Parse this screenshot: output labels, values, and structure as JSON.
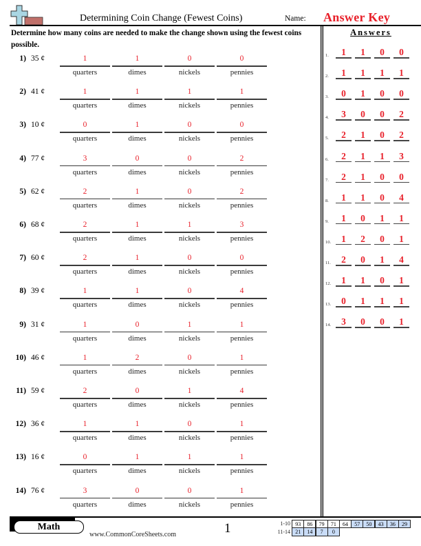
{
  "header": {
    "title": "Determining Coin Change (Fewest Coins)",
    "name_label": "Name:",
    "answer_key": "Answer Key"
  },
  "instructions": "Determine how many coins are needed to make the change shown using the fewest coins possible.",
  "coin_labels": [
    "quarters",
    "dimes",
    "nickels",
    "pennies"
  ],
  "problems": [
    {
      "num": "1)",
      "amount": "35 ¢",
      "answers": [
        "1",
        "1",
        "0",
        "0"
      ]
    },
    {
      "num": "2)",
      "amount": "41 ¢",
      "answers": [
        "1",
        "1",
        "1",
        "1"
      ]
    },
    {
      "num": "3)",
      "amount": "10 ¢",
      "answers": [
        "0",
        "1",
        "0",
        "0"
      ]
    },
    {
      "num": "4)",
      "amount": "77 ¢",
      "answers": [
        "3",
        "0",
        "0",
        "2"
      ]
    },
    {
      "num": "5)",
      "amount": "62 ¢",
      "answers": [
        "2",
        "1",
        "0",
        "2"
      ]
    },
    {
      "num": "6)",
      "amount": "68 ¢",
      "answers": [
        "2",
        "1",
        "1",
        "3"
      ]
    },
    {
      "num": "7)",
      "amount": "60 ¢",
      "answers": [
        "2",
        "1",
        "0",
        "0"
      ]
    },
    {
      "num": "8)",
      "amount": "39 ¢",
      "answers": [
        "1",
        "1",
        "0",
        "4"
      ]
    },
    {
      "num": "9)",
      "amount": "31 ¢",
      "answers": [
        "1",
        "0",
        "1",
        "1"
      ]
    },
    {
      "num": "10)",
      "amount": "46 ¢",
      "answers": [
        "1",
        "2",
        "0",
        "1"
      ]
    },
    {
      "num": "11)",
      "amount": "59 ¢",
      "answers": [
        "2",
        "0",
        "1",
        "4"
      ]
    },
    {
      "num": "12)",
      "amount": "36 ¢",
      "answers": [
        "1",
        "1",
        "0",
        "1"
      ]
    },
    {
      "num": "13)",
      "amount": "16 ¢",
      "answers": [
        "0",
        "1",
        "1",
        "1"
      ]
    },
    {
      "num": "14)",
      "amount": "76 ¢",
      "answers": [
        "3",
        "0",
        "0",
        "1"
      ]
    }
  ],
  "answers_panel": {
    "title": "Answers",
    "rows": [
      {
        "num": "1.",
        "values": [
          "1",
          "1",
          "0",
          "0"
        ]
      },
      {
        "num": "2.",
        "values": [
          "1",
          "1",
          "1",
          "1"
        ]
      },
      {
        "num": "3.",
        "values": [
          "0",
          "1",
          "0",
          "0"
        ]
      },
      {
        "num": "4.",
        "values": [
          "3",
          "0",
          "0",
          "2"
        ]
      },
      {
        "num": "5.",
        "values": [
          "2",
          "1",
          "0",
          "2"
        ]
      },
      {
        "num": "6.",
        "values": [
          "2",
          "1",
          "1",
          "3"
        ]
      },
      {
        "num": "7.",
        "values": [
          "2",
          "1",
          "0",
          "0"
        ]
      },
      {
        "num": "8.",
        "values": [
          "1",
          "1",
          "0",
          "4"
        ]
      },
      {
        "num": "9.",
        "values": [
          "1",
          "0",
          "1",
          "1"
        ]
      },
      {
        "num": "10.",
        "values": [
          "1",
          "2",
          "0",
          "1"
        ]
      },
      {
        "num": "11.",
        "values": [
          "2",
          "0",
          "1",
          "4"
        ]
      },
      {
        "num": "12.",
        "values": [
          "1",
          "1",
          "0",
          "1"
        ]
      },
      {
        "num": "13.",
        "values": [
          "0",
          "1",
          "1",
          "1"
        ]
      },
      {
        "num": "14.",
        "values": [
          "3",
          "0",
          "0",
          "1"
        ]
      }
    ]
  },
  "footer": {
    "subject": "Math",
    "site": "www.CommonCoreSheets.com",
    "page": "1",
    "score_rows": [
      {
        "label": "1-10",
        "cells": [
          {
            "v": "93",
            "blue": false
          },
          {
            "v": "86",
            "blue": false
          },
          {
            "v": "79",
            "blue": false
          },
          {
            "v": "71",
            "blue": false
          },
          {
            "v": "64",
            "blue": false
          },
          {
            "v": "57",
            "blue": true
          },
          {
            "v": "50",
            "blue": true
          },
          {
            "v": "43",
            "blue": true
          },
          {
            "v": "36",
            "blue": true
          },
          {
            "v": "29",
            "blue": true
          }
        ]
      },
      {
        "label": "11-14",
        "cells": [
          {
            "v": "21",
            "blue": true
          },
          {
            "v": "14",
            "blue": true
          },
          {
            "v": "7",
            "blue": true
          },
          {
            "v": "0",
            "blue": true
          }
        ]
      }
    ]
  },
  "colors": {
    "answer_red": "#e8202a",
    "score_blue": "#c9dcf7",
    "logo_cross": "#a9d6e3",
    "logo_bar": "#c0706a"
  }
}
